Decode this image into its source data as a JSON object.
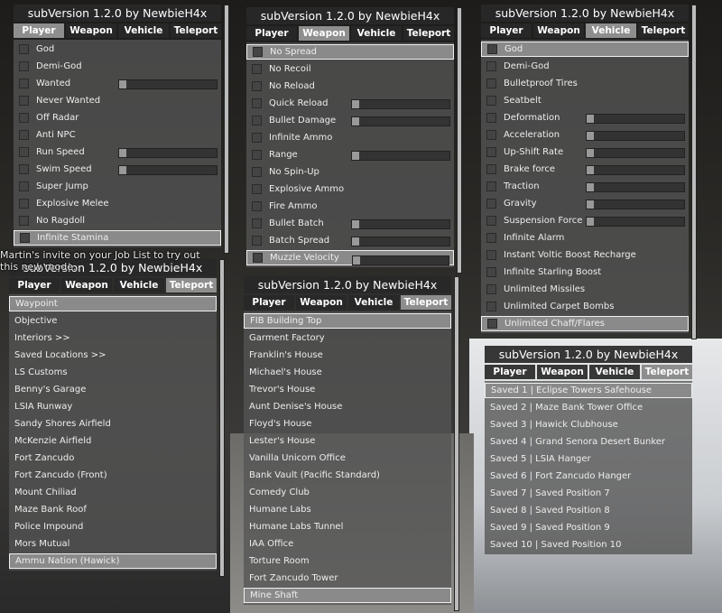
{
  "background_text": [
    "Martin's invite on your Job List to try out",
    "this new mode."
  ],
  "tabs": [
    "Player",
    "Weapon",
    "Vehicle",
    "Teleport"
  ],
  "colors": {
    "panel": "#555555",
    "selected": "#8a8a8a",
    "active_tab": "#8e8e8e",
    "header": "#282828"
  },
  "panels": [
    {
      "title": "subVersion 1.2.0 by NewbieH4x",
      "active_tab": 0,
      "checkbox": true,
      "selected": 0,
      "items": [
        {
          "label": "God"
        },
        {
          "label": "Demi-God"
        },
        {
          "label": "Wanted",
          "slider": 0
        },
        {
          "label": "Never Wanted"
        },
        {
          "label": "Off Radar"
        },
        {
          "label": "Anti NPC"
        },
        {
          "label": "Run Speed",
          "slider": 0
        },
        {
          "label": "Swim Speed",
          "slider": 0
        },
        {
          "label": "Super Jump"
        },
        {
          "label": "Explosive Melee"
        },
        {
          "label": "No Ragdoll"
        },
        {
          "label": "Infinite Stamina",
          "selected": true
        }
      ]
    },
    {
      "title": "subVersion 1.2.0 by NewbieH4x",
      "active_tab": 1,
      "checkbox": true,
      "items": [
        {
          "label": "No Spread",
          "selected": true
        },
        {
          "label": "No Recoil"
        },
        {
          "label": "No Reload"
        },
        {
          "label": "Quick Reload",
          "slider": 0
        },
        {
          "label": "Bullet Damage",
          "slider": 0
        },
        {
          "label": "Infinite Ammo"
        },
        {
          "label": "Range",
          "slider": 0
        },
        {
          "label": "No Spin-Up"
        },
        {
          "label": "Explosive Ammo"
        },
        {
          "label": "Fire Ammo"
        },
        {
          "label": "Bullet Batch",
          "slider": 0
        },
        {
          "label": "Batch Spread",
          "slider": 0
        },
        {
          "label": "Muzzle Velocity",
          "slider": 0,
          "selected": true
        }
      ]
    },
    {
      "title": "subVersion 1.2.0 by NewbieH4x",
      "active_tab": 2,
      "checkbox": true,
      "items": [
        {
          "label": "God",
          "selected": true
        },
        {
          "label": "Demi-God"
        },
        {
          "label": "Bulletproof Tires"
        },
        {
          "label": "Seatbelt"
        },
        {
          "label": "Deformation",
          "slider": 0
        },
        {
          "label": "Acceleration",
          "slider": 0
        },
        {
          "label": "Up-Shift Rate",
          "slider": 0
        },
        {
          "label": "Brake force",
          "slider": 0
        },
        {
          "label": "Traction",
          "slider": 0
        },
        {
          "label": "Gravity",
          "slider": 0
        },
        {
          "label": "Suspension Force",
          "slider": 0
        },
        {
          "label": "Infinite Alarm"
        },
        {
          "label": "Instant Voltic Boost Recharge"
        },
        {
          "label": "Infinite Starling Boost"
        },
        {
          "label": "Unlimited Missiles"
        },
        {
          "label": "Unlimited Carpet Bombs"
        },
        {
          "label": "Unlimited Chaff/Flares",
          "selected": true
        }
      ]
    },
    {
      "title": "subVersion 1.2.0 by NewbieH4x",
      "active_tab": 3,
      "checkbox": false,
      "items": [
        {
          "label": "Waypoint",
          "selected": true
        },
        {
          "label": "Objective"
        },
        {
          "label": "Interiors >>"
        },
        {
          "label": "Saved Locations >>"
        },
        {
          "label": "LS Customs"
        },
        {
          "label": "Benny's Garage"
        },
        {
          "label": "LSIA Runway"
        },
        {
          "label": "Sandy Shores Airfield"
        },
        {
          "label": "McKenzie Airfield"
        },
        {
          "label": "Fort Zancudo"
        },
        {
          "label": "Fort Zancudo (Front)"
        },
        {
          "label": "Mount Chiliad"
        },
        {
          "label": "Maze Bank Roof"
        },
        {
          "label": "Police Impound"
        },
        {
          "label": "Mors Mutual"
        },
        {
          "label": "Ammu Nation (Hawick)",
          "selected": true
        }
      ]
    },
    {
      "title": "subVersion 1.2.0 by NewbieH4x",
      "active_tab": 3,
      "checkbox": false,
      "items": [
        {
          "label": "FIB Building Top",
          "selected": true
        },
        {
          "label": "Garment Factory"
        },
        {
          "label": "Franklin's House"
        },
        {
          "label": "Michael's House"
        },
        {
          "label": "Trevor's House"
        },
        {
          "label": "Aunt Denise's House"
        },
        {
          "label": "Floyd's House"
        },
        {
          "label": "Lester's House"
        },
        {
          "label": "Vanilla Unicorn Office"
        },
        {
          "label": "Bank Vault (Pacific Standard)"
        },
        {
          "label": "Comedy Club"
        },
        {
          "label": "Humane Labs"
        },
        {
          "label": "Humane Labs Tunnel"
        },
        {
          "label": "IAA Office"
        },
        {
          "label": "Torture Room"
        },
        {
          "label": "Fort Zancudo Tower"
        },
        {
          "label": "Mine Shaft",
          "selected": true
        }
      ]
    },
    {
      "title": "subVersion 1.2.0 by NewbieH4x",
      "active_tab": 3,
      "checkbox": false,
      "items": [
        {
          "label": "Saved 1 | Eclipse Towers Safehouse",
          "selected": true
        },
        {
          "label": "Saved 2 | Maze Bank Tower Office"
        },
        {
          "label": "Saved 3 | Hawick Clubhouse"
        },
        {
          "label": "Saved 4 | Grand Senora Desert Bunker"
        },
        {
          "label": "Saved 5 | LSIA Hanger"
        },
        {
          "label": "Saved 6 | Fort Zancudo Hanger"
        },
        {
          "label": "Saved 7 | Saved Position 7"
        },
        {
          "label": "Saved 8 | Saved Position 8"
        },
        {
          "label": "Saved 9 | Saved Position 9"
        },
        {
          "label": "Saved 10 | Saved Position 10"
        }
      ]
    }
  ]
}
